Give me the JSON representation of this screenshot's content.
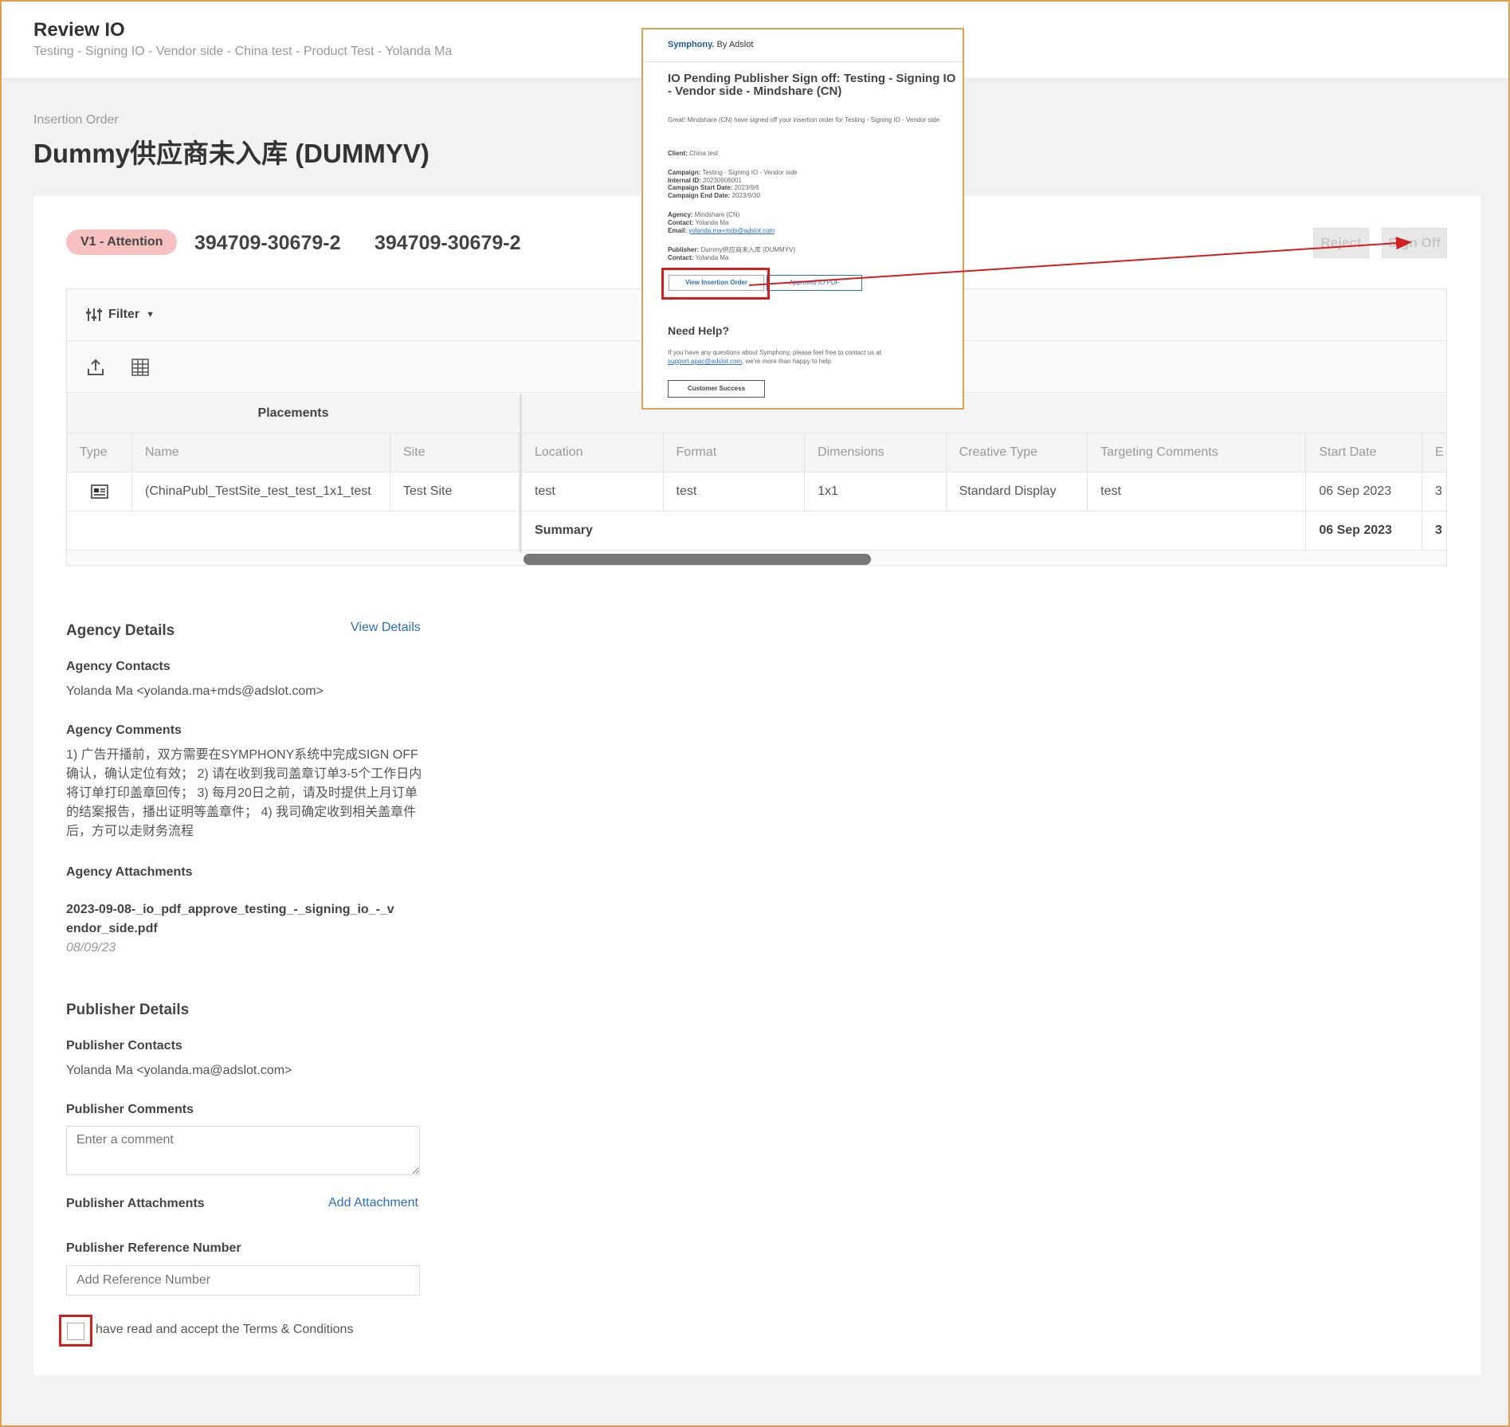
{
  "header": {
    "title": "Review IO",
    "subtitle": "Testing - Signing IO - Vendor side - China test - Product Test - Yolanda Ma"
  },
  "insertion_order": {
    "label": "Insertion Order",
    "title": "Dummy供应商未入库 (DUMMYV)"
  },
  "card": {
    "badge": "V1 - Attention",
    "io_number_1": "394709-30679-2",
    "io_number_2": "394709-30679-2",
    "reject_label": "Reject",
    "signoff_label": "Sign Off"
  },
  "grid": {
    "filter_label": "Filter",
    "group_header": "Placements",
    "left_columns": [
      "Type",
      "Name",
      "Site"
    ],
    "right_columns": [
      "Location",
      "Format",
      "Dimensions",
      "Creative Type",
      "Targeting Comments",
      "Start Date",
      "E"
    ],
    "row": {
      "name": "(ChinaPubl_TestSite_test_test_1x1_test",
      "site": "Test Site",
      "location": "test",
      "format": "test",
      "dimensions": "1x1",
      "creative_type": "Standard Display",
      "targeting_comments": "test",
      "start_date": "06 Sep 2023",
      "end_trunc": "3"
    },
    "summary": {
      "label": "Summary",
      "start_date": "06 Sep 2023",
      "end_trunc": "3"
    }
  },
  "agency": {
    "title": "Agency Details",
    "view_details": "View Details",
    "contacts_label": "Agency Contacts",
    "contacts": "Yolanda Ma <yolanda.ma+mds@adslot.com>",
    "comments_label": "Agency Comments",
    "comments": "1) 广告开播前，双方需要在SYMPHONY系统中完成SIGN OFF确认，确认定位有效； 2) 请在收到我司盖章订单3-5个工作日内将订单打印盖章回传； 3) 每月20日之前，请及时提供上月订单的结案报告，播出证明等盖章件； 4) 我司确定收到相关盖章件后，方可以走财务流程",
    "attachments_label": "Agency Attachments",
    "attachment_name": "2023-09-08-_io_pdf_approve_testing_-_signing_io_-_vendor_side.pdf",
    "attachment_date": "08/09/23"
  },
  "publisher": {
    "title": "Publisher Details",
    "contacts_label": "Publisher Contacts",
    "contacts": "Yolanda Ma <yolanda.ma@adslot.com>",
    "comments_label": "Publisher Comments",
    "comments_placeholder": "Enter a comment",
    "attachments_label": "Publisher Attachments",
    "add_attachment": "Add Attachment",
    "reference_label": "Publisher Reference Number",
    "reference_placeholder": "Add Reference Number",
    "terms_label": "have read and accept the Terms & Conditions"
  },
  "email": {
    "logo_brand": "Symphony.",
    "logo_suffix": "By Adslot",
    "title": "IO Pending Publisher Sign off: Testing - Signing IO - Vendor side - Mindshare (CN)",
    "intro": "Great! Mindshare (CN) have signed off your insertion order for Testing - Signing IO - Vendor side",
    "client_label": "Client:",
    "client": "China test",
    "campaign_label": "Campaign:",
    "campaign": "Testing - Signing IO - Vendor side",
    "internal_id_label": "Internal ID:",
    "internal_id": "20230906001",
    "start_label": "Campaign Start Date:",
    "start": "2023/9/6",
    "end_label": "Campaign End Date:",
    "end": "2023/9/30",
    "agency_label": "Agency:",
    "agency": "Mindshare (CN)",
    "contact_label": "Contact:",
    "contact": "Yolanda Ma",
    "email_label": "Email:",
    "email": "yolanda.ma+mds@adslot.com",
    "publisher_label": "Publisher:",
    "publisher": "Dummy供应商未入库 (DUMMYV)",
    "pub_contact_label": "Contact:",
    "pub_contact": "Yolanda Ma",
    "btn_view": "View Insertion Order",
    "btn_pdf": "Approved IO PDF",
    "need_help": "Need Help?",
    "help_text": "If you have any questions about Symphony, please feel free to contact us at",
    "help_link": "support.apac@adslot.com",
    "help_text2": ", we're more than happy to help.",
    "cs_button": "Customer Success"
  },
  "colors": {
    "badge_bg": "#f8c1c1",
    "link": "#2a6fc0",
    "highlight": "#d02020",
    "frame": "#e0a050"
  }
}
